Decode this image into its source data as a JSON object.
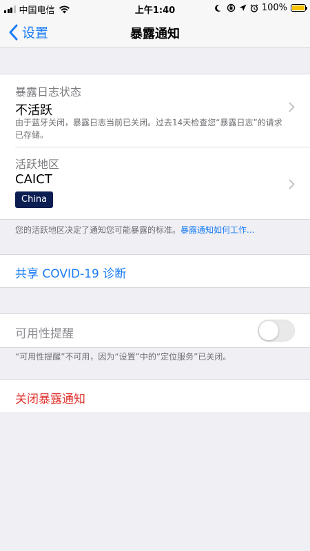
{
  "status_bar": {
    "carrier": "中国电信",
    "time": "上午1:40",
    "battery": "100%",
    "battery_level": 1.0,
    "battery_color": "#f6c100"
  },
  "nav": {
    "back_label": "设置",
    "title": "暴露通知"
  },
  "log_status": {
    "label": "暴露日志状态",
    "value": "不活跃",
    "description": "由于蓝牙关闭，暴露日志当前已关闭。过去14天检查您“暴露日志”的请求已存储。"
  },
  "region": {
    "label": "活跃地区",
    "value": "CAICT",
    "badge": "China",
    "badge_color": "#0b1e52"
  },
  "region_footer": {
    "text": "您的活跃地区决定了通知您可能暴露的标准。",
    "link": "暴露通知如何工作..."
  },
  "share": {
    "label": "共享 COVID-19 诊断"
  },
  "availability": {
    "label": "可用性提醒",
    "enabled": false,
    "footer": "“可用性提醒”不可用，因为“设置”中的“定位服务”已关闭。"
  },
  "turn_off": {
    "label": "关闭暴露通知"
  },
  "colors": {
    "accent": "#1a7cf5",
    "destructive": "#e0332e",
    "background": "#efeff4"
  }
}
